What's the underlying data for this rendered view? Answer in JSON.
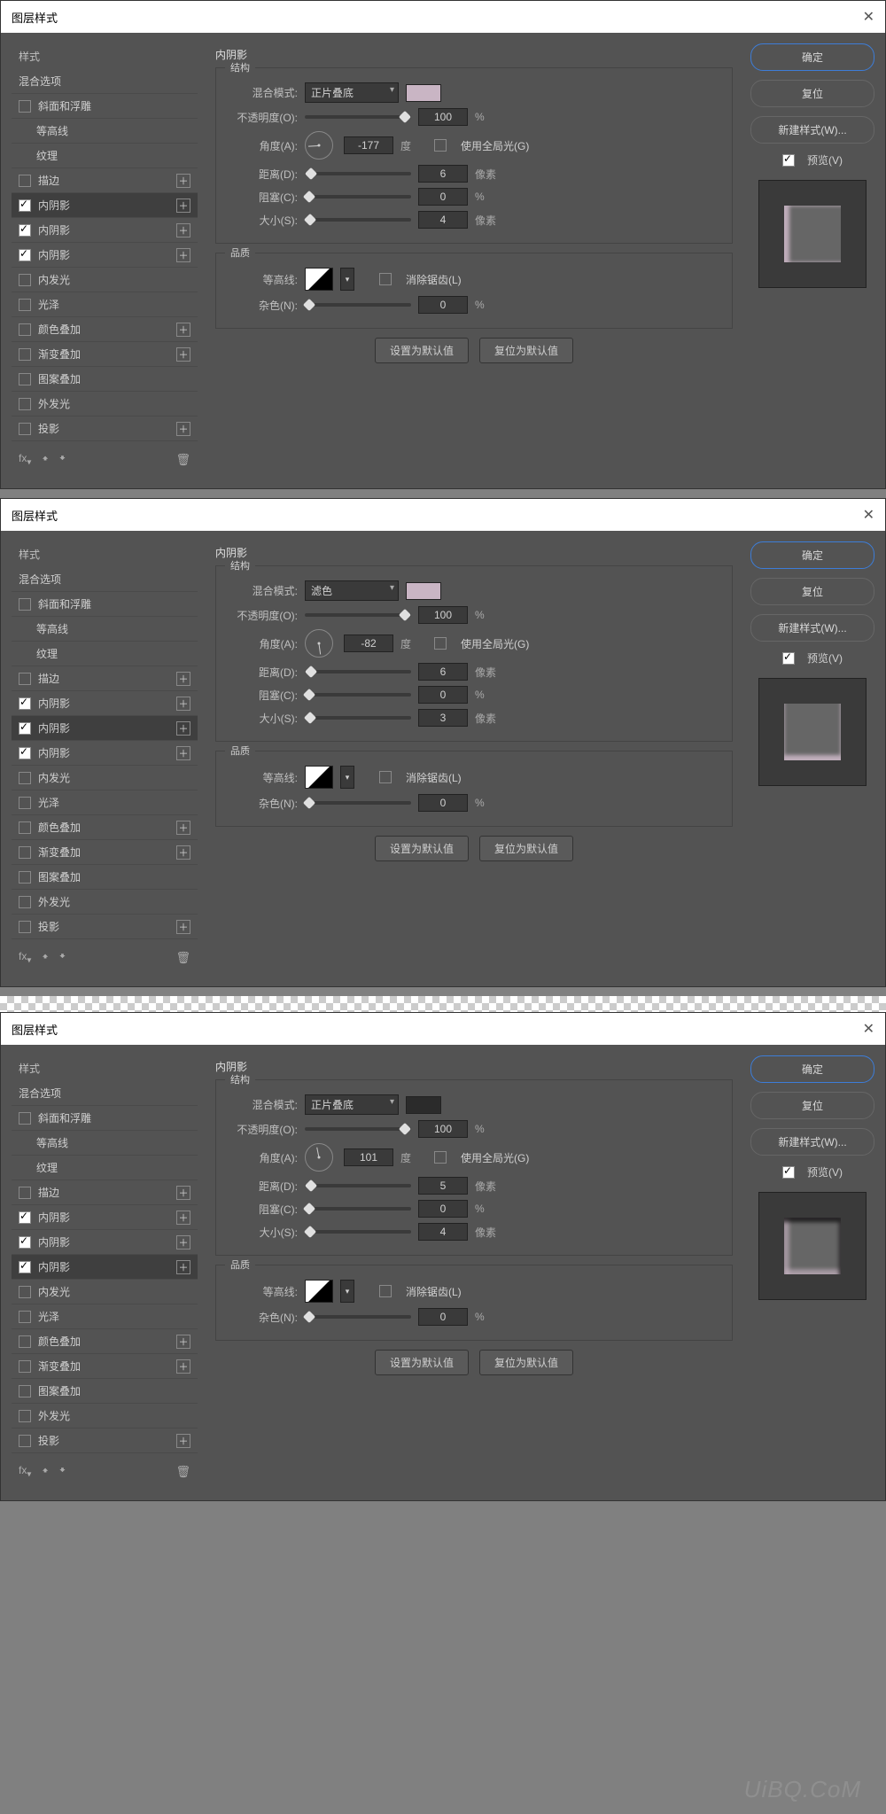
{
  "common": {
    "title": "图层样式",
    "close": "✕",
    "styles_label": "样式",
    "blend_options": "混合选项",
    "panel_title": "内阴影",
    "set_default": "设置为默认值",
    "reset_default": "复位为默认值",
    "ok": "确定",
    "cancel": "复位",
    "new_style": "新建样式(W)...",
    "preview": "预览(V)",
    "structure": "结构",
    "quality": "品质",
    "blend_mode_label": "混合模式:",
    "opacity_label": "不透明度(O):",
    "angle_label": "角度(A):",
    "degree": "度",
    "global_light": "使用全局光(G)",
    "distance_label": "距离(D):",
    "choke_label": "阻塞(C):",
    "size_label": "大小(S):",
    "contour_label": "等高线:",
    "antialias": "消除锯齿(L)",
    "noise_label": "杂色(N):",
    "px": "像素",
    "pct": "%",
    "fx": "fx"
  },
  "effects": {
    "bevel": "斜面和浮雕",
    "contour": "等高线",
    "texture": "纹理",
    "stroke": "描边",
    "inner_shadow": "内阴影",
    "inner_glow": "内发光",
    "satin": "光泽",
    "color_overlay": "颜色叠加",
    "gradient_overlay": "渐变叠加",
    "pattern_overlay": "图案叠加",
    "outer_glow": "外发光",
    "drop_shadow": "投影"
  },
  "panel1": {
    "blend_mode": "正片叠底",
    "swatch": "#c9b5c4",
    "opacity": "100",
    "angle": "-177",
    "distance": "6",
    "choke": "0",
    "size": "4",
    "noise": "0",
    "active_idx": 0,
    "preview_shadow": "inset 6px 0 4px rgba(201,181,196,.9)"
  },
  "panel2": {
    "blend_mode": "滤色",
    "swatch": "#c9b5c4",
    "opacity": "100",
    "angle": "-82",
    "distance": "6",
    "choke": "0",
    "size": "3",
    "noise": "0",
    "active_idx": 1,
    "preview_shadow": "inset 0 -6px 4px rgba(201,181,196,.9)"
  },
  "panel3": {
    "blend_mode": "正片叠底",
    "swatch": "#2b2b2b",
    "opacity": "100",
    "angle": "101",
    "distance": "5",
    "choke": "0",
    "size": "4",
    "noise": "0",
    "active_idx": 2,
    "preview_shadow": "inset -2px 5px 5px rgba(0,0,0,.7), inset 6px 0 4px rgba(201,181,196,.6), inset 0 -6px 4px rgba(201,181,196,.6)"
  },
  "watermark": "UiBQ.CoM"
}
